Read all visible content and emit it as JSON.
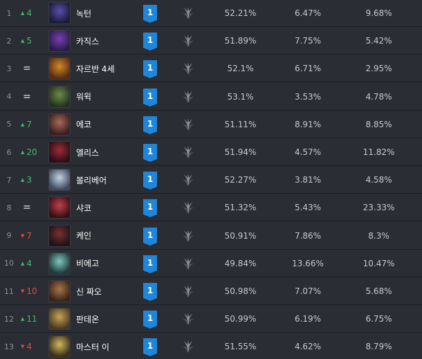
{
  "colors": {
    "row_bg": "#2b2d34",
    "up": "#3cbf6a",
    "down": "#e0484a",
    "tier_badge": "#1f86d9"
  },
  "rows": [
    {
      "rank": "1",
      "dir": "up",
      "change": "4",
      "name": "녹턴",
      "tier": "1",
      "win": "52.21%",
      "pick": "6.47%",
      "ban": "9.68%",
      "colors": [
        "#1b1b3a",
        "#5a4fa8"
      ]
    },
    {
      "rank": "2",
      "dir": "up",
      "change": "5",
      "name": "카직스",
      "tier": "1",
      "win": "51.89%",
      "pick": "7.75%",
      "ban": "5.42%",
      "colors": [
        "#2a1d4a",
        "#7a3fb0"
      ]
    },
    {
      "rank": "3",
      "dir": "same",
      "change": "=",
      "name": "자르반 4세",
      "tier": "1",
      "win": "52.1%",
      "pick": "6.71%",
      "ban": "2.95%",
      "colors": [
        "#5a2b10",
        "#d08a2a"
      ]
    },
    {
      "rank": "4",
      "dir": "same",
      "change": "=",
      "name": "워윅",
      "tier": "1",
      "win": "53.1%",
      "pick": "3.53%",
      "ban": "4.78%",
      "colors": [
        "#24331f",
        "#6d8a4c"
      ]
    },
    {
      "rank": "5",
      "dir": "up",
      "change": "7",
      "name": "에코",
      "tier": "1",
      "win": "51.11%",
      "pick": "8.91%",
      "ban": "8.85%",
      "colors": [
        "#3a1f20",
        "#a86a5a"
      ]
    },
    {
      "rank": "6",
      "dir": "up",
      "change": "20",
      "name": "엘리스",
      "tier": "1",
      "win": "51.94%",
      "pick": "4.57%",
      "ban": "11.82%",
      "colors": [
        "#2a0f16",
        "#a02a3a"
      ]
    },
    {
      "rank": "7",
      "dir": "up",
      "change": "3",
      "name": "볼리베어",
      "tier": "1",
      "win": "52.27%",
      "pick": "3.81%",
      "ban": "4.58%",
      "colors": [
        "#3d4a5e",
        "#c5d2e0"
      ]
    },
    {
      "rank": "8",
      "dir": "same",
      "change": "=",
      "name": "샤코",
      "tier": "1",
      "win": "51.32%",
      "pick": "5.43%",
      "ban": "23.33%",
      "colors": [
        "#3a0f14",
        "#c04050"
      ]
    },
    {
      "rank": "9",
      "dir": "down",
      "change": "7",
      "name": "케인",
      "tier": "1",
      "win": "50.91%",
      "pick": "7.86%",
      "ban": "8.3%",
      "colors": [
        "#1d1418",
        "#7a3030"
      ]
    },
    {
      "rank": "10",
      "dir": "up",
      "change": "4",
      "name": "비에고",
      "tier": "1",
      "win": "49.84%",
      "pick": "13.66%",
      "ban": "10.47%",
      "colors": [
        "#1f3a3a",
        "#7fc8c0"
      ]
    },
    {
      "rank": "11",
      "dir": "down",
      "change": "10",
      "name": "신 짜오",
      "tier": "1",
      "win": "50.98%",
      "pick": "7.07%",
      "ban": "5.68%",
      "colors": [
        "#3a2418",
        "#a8744a"
      ]
    },
    {
      "rank": "12",
      "dir": "up",
      "change": "11",
      "name": "판테온",
      "tier": "1",
      "win": "50.99%",
      "pick": "6.19%",
      "ban": "6.75%",
      "colors": [
        "#4a3a20",
        "#c8a45a"
      ]
    },
    {
      "rank": "13",
      "dir": "down",
      "change": "4",
      "name": "마스터 이",
      "tier": "1",
      "win": "51.55%",
      "pick": "4.62%",
      "ban": "8.79%",
      "colors": [
        "#3a3018",
        "#d2b860"
      ]
    }
  ]
}
